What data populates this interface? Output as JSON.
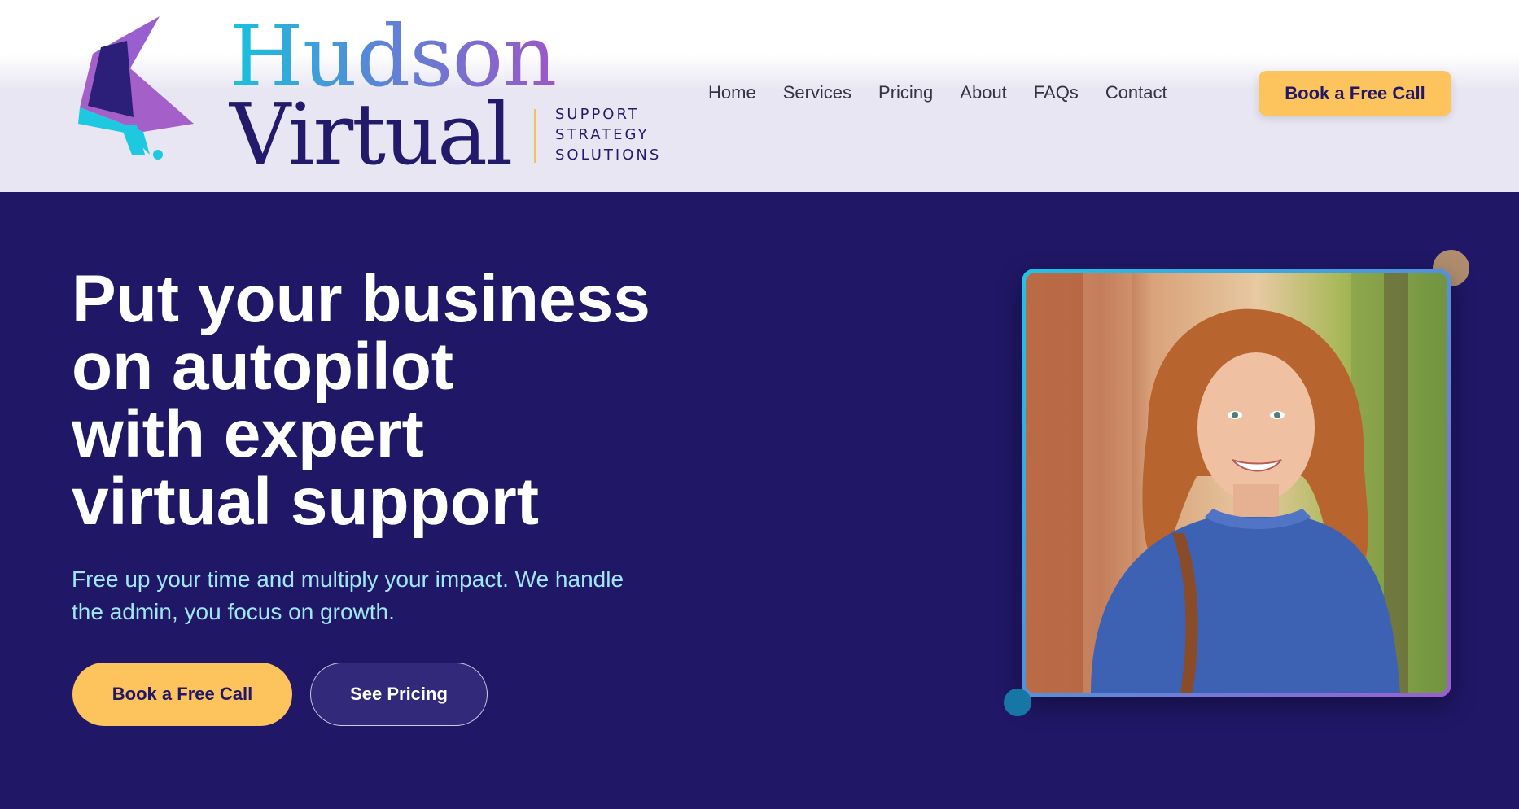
{
  "brand": {
    "name_line1": "Hudson",
    "name_line2": "Virtual",
    "tagline": [
      "SUPPORT",
      "STRATEGY",
      "SOLUTIONS"
    ],
    "logo_icon": "star-shard-logo-icon"
  },
  "nav": {
    "items": [
      {
        "label": "Home"
      },
      {
        "label": "Services"
      },
      {
        "label": "Pricing"
      },
      {
        "label": "About"
      },
      {
        "label": "FAQs"
      },
      {
        "label": "Contact"
      }
    ],
    "cta_label": "Book a Free Call"
  },
  "hero": {
    "title_lines": [
      "Put your business",
      "on autopilot",
      "with expert",
      "virtual support"
    ],
    "subtitle_lines": [
      "Free up your time and multiply your impact. We handle",
      "the admin, you focus on growth."
    ],
    "primary_cta": "Book a Free Call",
    "secondary_cta": "See Pricing",
    "image_alt": "Smiling woman with wavy auburn hair wearing a blue knit sweater"
  },
  "colors": {
    "background": "#201766",
    "accent_yellow": "#fdc45d",
    "accent_cyan": "#1fc4e4",
    "accent_purple": "#9a5fcf",
    "subtitle_text": "#9fe7f5"
  }
}
